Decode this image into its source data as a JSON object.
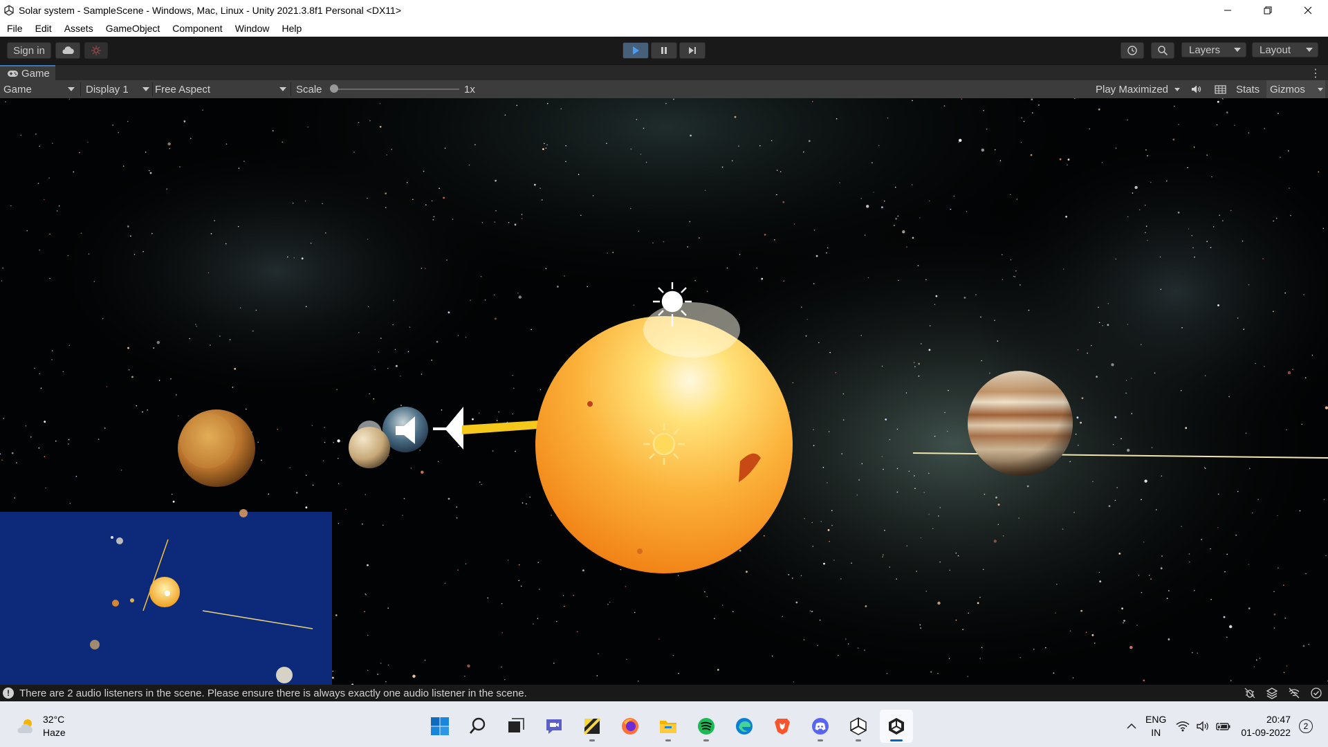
{
  "window": {
    "title": "Solar system - SampleScene - Windows, Mac, Linux - Unity 2021.3.8f1 Personal <DX11>"
  },
  "menu": [
    "File",
    "Edit",
    "Assets",
    "GameObject",
    "Component",
    "Window",
    "Help"
  ],
  "toolbar": {
    "sign_in": "Sign in",
    "layers": "Layers",
    "layout": "Layout"
  },
  "game_tab": {
    "label": "Game"
  },
  "game_bar": {
    "view_mode": "Game",
    "display": "Display 1",
    "aspect": "Free Aspect",
    "scale_label": "Scale",
    "scale_value": "1x",
    "play_mode": "Play Maximized",
    "stats": "Stats",
    "gizmos": "Gizmos"
  },
  "status": {
    "message": "There are 2 audio listeners in the scene. Please ensure there is always exactly one audio listener in the scene."
  },
  "taskbar": {
    "weather": {
      "temp": "32°C",
      "condition": "Haze"
    },
    "apps": [
      "windows-start-icon",
      "search-icon",
      "task-view-icon",
      "teams-chat-icon",
      "sticky-notes-icon",
      "firefox-icon",
      "file-explorer-icon",
      "spotify-icon",
      "edge-icon",
      "brave-icon",
      "discord-icon",
      "unity-hub-icon",
      "unity-editor-icon"
    ],
    "lang_line1": "ENG",
    "lang_line2": "IN",
    "time": "20:47",
    "date": "01-09-2022",
    "notification_count": "2"
  },
  "colors": {
    "unity_dark": "#191919",
    "unity_panel": "#3c3c3c",
    "accent_blue": "#3a79bb",
    "minimap_blue": "#0d2a7a",
    "sun_orange": "#f7a52a"
  }
}
